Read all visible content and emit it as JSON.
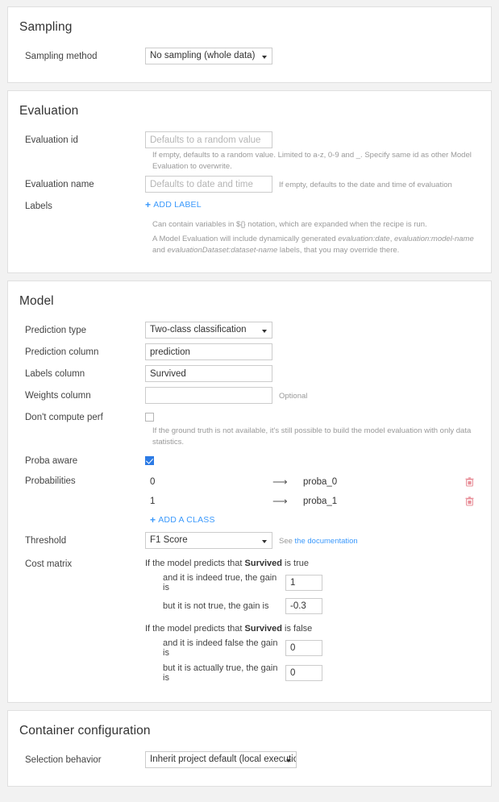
{
  "sampling": {
    "title": "Sampling",
    "method_label": "Sampling method",
    "method_value": "No sampling (whole data)"
  },
  "evaluation": {
    "title": "Evaluation",
    "id_label": "Evaluation id",
    "id_placeholder": "Defaults to a random value",
    "id_value": "",
    "id_help": "If empty, defaults to a random value. Limited to a-z, 0-9 and _. Specify same id as other Model Evaluation to overwrite.",
    "name_label": "Evaluation name",
    "name_placeholder": "Defaults to date and time",
    "name_value": "",
    "name_help": "If empty, defaults to the date and time of evaluation",
    "labels_label": "Labels",
    "add_label_link": "ADD LABEL",
    "labels_help_1": "Can contain variables in ${} notation, which are expanded when the recipe is run.",
    "labels_help_2_a": "A Model Evaluation will include dynamically generated ",
    "labels_help_2_i1": "evaluation:date",
    "labels_help_2_b": ", ",
    "labels_help_2_i2": "evaluation:model-name",
    "labels_help_2_c": " and ",
    "labels_help_2_i3": "evaluationDataset:dataset-name",
    "labels_help_2_d": " labels, that you may override there."
  },
  "model": {
    "title": "Model",
    "prediction_type_label": "Prediction type",
    "prediction_type_value": "Two-class classification",
    "prediction_column_label": "Prediction column",
    "prediction_column_value": "prediction",
    "labels_column_label": "Labels column",
    "labels_column_value": "Survived",
    "weights_column_label": "Weights column",
    "weights_column_value": "",
    "weights_optional": "Optional",
    "dont_compute_label": "Don't compute perf",
    "dont_compute_checked": false,
    "dont_compute_help": "If the ground truth is not available, it's still possible to build the model evaluation with only data statistics.",
    "proba_aware_label": "Proba aware",
    "proba_aware_checked": true,
    "probabilities_label": "Probabilities",
    "probabilities": [
      {
        "class": "0",
        "arrow": "⟶",
        "column": "proba_0"
      },
      {
        "class": "1",
        "arrow": "⟶",
        "column": "proba_1"
      }
    ],
    "add_class_link": "ADD A CLASS",
    "threshold_label": "Threshold",
    "threshold_value": "F1 Score",
    "threshold_help_prefix": "See ",
    "threshold_help_link": "the documentation",
    "cost_matrix_label": "Cost matrix",
    "cost_matrix": {
      "true_head_a": "If the model predicts that ",
      "true_head_bold": "Survived",
      "true_head_b": " is true",
      "true_true_text": "and it is indeed true, the gain is",
      "true_true_value": "1",
      "true_false_text": "but it is not true, the gain is",
      "true_false_value": "-0.3",
      "false_head_a": "If the model predicts that ",
      "false_head_bold": "Survived",
      "false_head_b": " is false",
      "false_false_text": "and it is indeed false the gain is",
      "false_false_value": "0",
      "false_true_text": "but it is actually true, the gain is",
      "false_true_value": "0"
    }
  },
  "container": {
    "title": "Container configuration",
    "selection_label": "Selection behavior",
    "selection_value": "Inherit project default (local execution)"
  },
  "colors": {
    "accent_blue": "#3b99fc",
    "checkbox_blue": "#2c7be5",
    "trash_pink": "#e8909a",
    "page_bg": "#f2f2f2",
    "card_bg": "#ffffff",
    "border": "#e0e0e0"
  },
  "icons": {
    "caret": "chevron-down-icon",
    "plus": "plus-icon",
    "trash": "trash-icon",
    "arrow": "arrow-right-icon"
  }
}
